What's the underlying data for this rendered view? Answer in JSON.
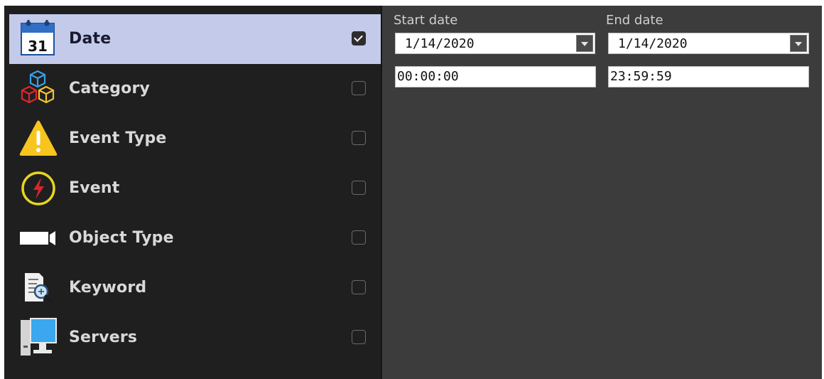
{
  "sidebar": {
    "items": [
      {
        "label": "Date",
        "icon": "calendar-icon",
        "icon_text": "31",
        "checked": true,
        "selected": true
      },
      {
        "label": "Category",
        "icon": "cubes-icon",
        "checked": false,
        "selected": false
      },
      {
        "label": "Event Type",
        "icon": "warning-triangle-icon",
        "checked": false,
        "selected": false
      },
      {
        "label": "Event",
        "icon": "lightning-circle-icon",
        "checked": false,
        "selected": false
      },
      {
        "label": "Object Type",
        "icon": "camera-icon",
        "checked": false,
        "selected": false
      },
      {
        "label": "Keyword",
        "icon": "document-search-icon",
        "checked": false,
        "selected": false
      },
      {
        "label": "Servers",
        "icon": "server-computer-icon",
        "checked": false,
        "selected": false
      }
    ]
  },
  "date_filter": {
    "start_date_label": "Start date",
    "end_date_label": "End date",
    "start_date_value": "1/14/2020",
    "end_date_value": "1/14/2020",
    "start_time_value": "00:00:00",
    "end_time_value": "23:59:59"
  },
  "colors": {
    "sidebar_bg": "#1f1f1f",
    "content_bg": "#3c3c3c",
    "selected_bg": "#c4cae9",
    "label_color": "#d9d9d9"
  }
}
